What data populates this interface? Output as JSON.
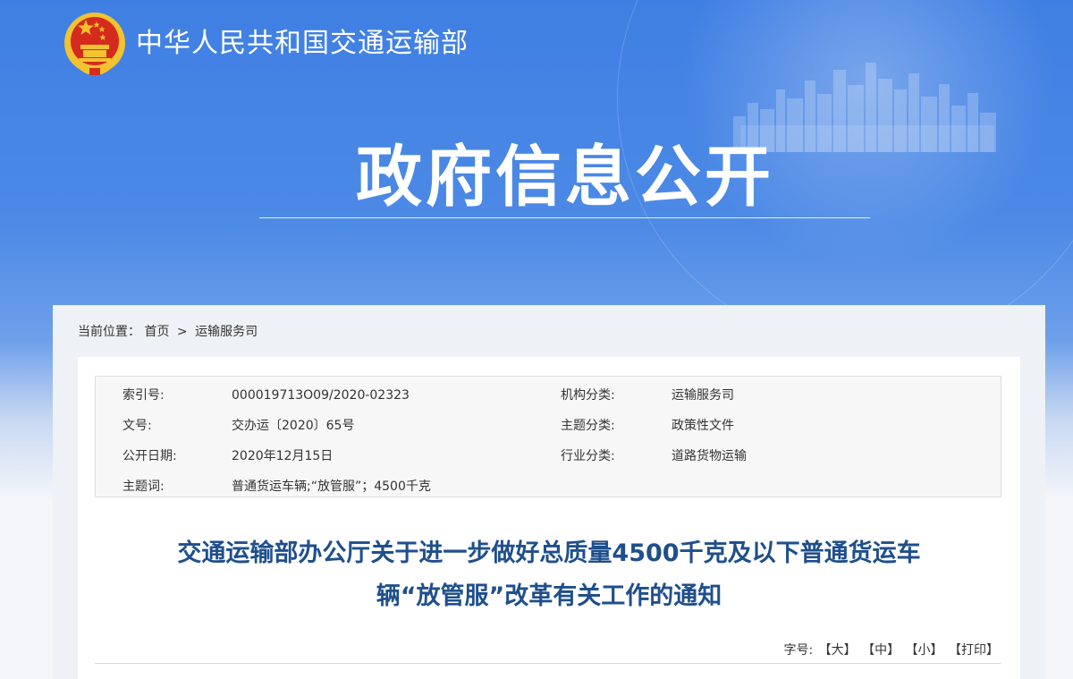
{
  "header": {
    "ministry_name": "中华人民共和国交通运输部",
    "section_title": "政府信息公开",
    "emblem_icon": "national-emblem-icon"
  },
  "breadcrumb": {
    "label": "当前位置：",
    "home": "首页",
    "separator": ">",
    "current": "运输服务司"
  },
  "metadata": {
    "rows": [
      {
        "k1": "索引号:",
        "v1": "000019713O09/2020-02323",
        "k2": "机构分类:",
        "v2": "运输服务司"
      },
      {
        "k1": "文号:",
        "v1": "交办运〔2020〕65号",
        "k2": "主题分类:",
        "v2": "政策性文件"
      },
      {
        "k1": "公开日期:",
        "v1": "2020年12月15日",
        "k2": "行业分类:",
        "v2": "道路货物运输"
      },
      {
        "k1": "主题词:",
        "v1": "普通货运车辆;“放管服”；4500千克",
        "k2": "",
        "v2": ""
      }
    ]
  },
  "document": {
    "title_line1": "交通运输部办公厅关于进一步做好总质量4500千克及以下普通货运车",
    "title_line2": "辆“放管服”改革有关工作的通知"
  },
  "font_size_controls": {
    "label": "字号:",
    "large": "【大】",
    "medium": "【中】",
    "small": "【小】",
    "print": "【打印】"
  },
  "colors": {
    "banner_blue": "#4a86e4",
    "title_blue": "#1f4f8c",
    "emblem_red": "#d52b1e",
    "emblem_gold": "#f2c230"
  }
}
